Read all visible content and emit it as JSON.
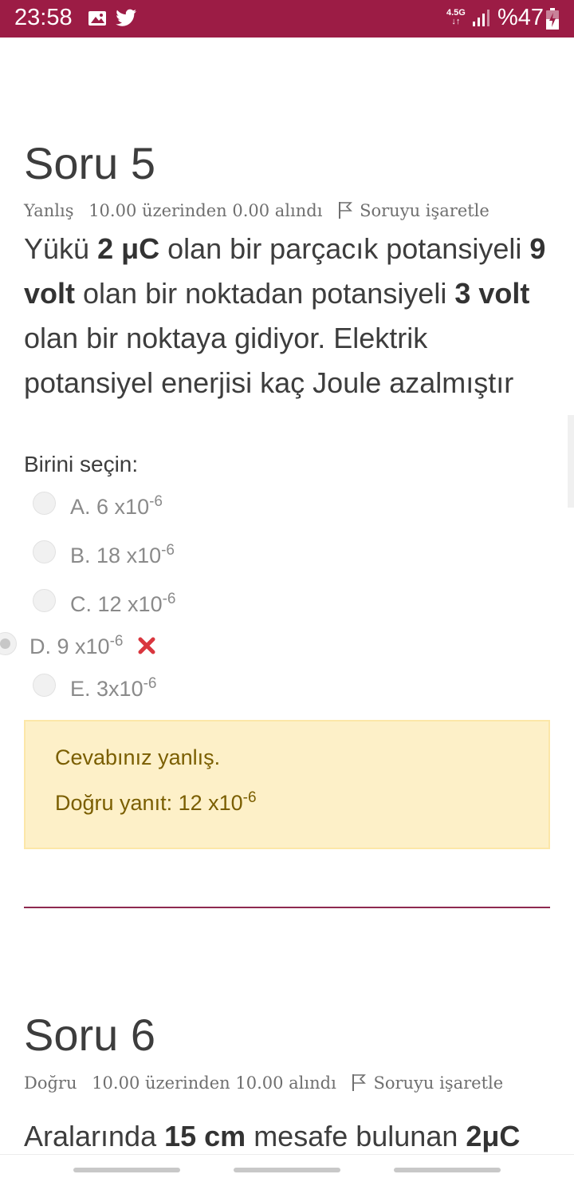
{
  "status_bar": {
    "time": "23:58",
    "network_top": "4.5G",
    "network_bottom": "↓↑",
    "battery_text": "%47",
    "icons": [
      "image-icon",
      "twitter-icon",
      "signal-icon",
      "battery-icon"
    ]
  },
  "colors": {
    "status_bar_bg": "#9c1c45",
    "divider": "#8e2a4f",
    "feedback_bg": "#fdf0c8",
    "feedback_text": "#7a5e00",
    "wrong_mark": "#d9363e"
  },
  "question5": {
    "title": "Soru 5",
    "status": "Yanlış",
    "score": "10.00 üzerinden 0.00 alındı",
    "flag_label": "Soruyu işaretle",
    "text_parts": [
      "Yükü ",
      "2 μC",
      " olan bir parçacık potansiyeli ",
      "9 volt",
      " olan bir noktadan potansiyeli ",
      "3 volt",
      " olan bir noktaya gidiyor. Elektrik potansiyel enerjisi kaç Joule azalmıştır"
    ],
    "prompt": "Birini seçin:",
    "options": [
      {
        "letter": "A.",
        "base": "6 x10",
        "exp": "-6"
      },
      {
        "letter": "B.",
        "base": "18 x10",
        "exp": "-6"
      },
      {
        "letter": "C.",
        "base": "12 x10",
        "exp": "-6"
      },
      {
        "letter": "D.",
        "base": "9 x10",
        "exp": "-6",
        "selected": true,
        "wrong": true
      },
      {
        "letter": "E.",
        "base": "3x10",
        "exp": "-6"
      }
    ],
    "feedback": {
      "result": "Cevabınız yanlış.",
      "correct_prefix": "Doğru yanıt: ",
      "correct_base": "12 x10",
      "correct_exp": "-6"
    }
  },
  "question6": {
    "title": "Soru 6",
    "status": "Doğru",
    "score": "10.00 üzerinden 10.00 alındı",
    "flag_label": "Soruyu işaretle",
    "text_parts": [
      "Aralarında ",
      "15 cm",
      " mesafe bulunan ",
      "2μC"
    ]
  }
}
